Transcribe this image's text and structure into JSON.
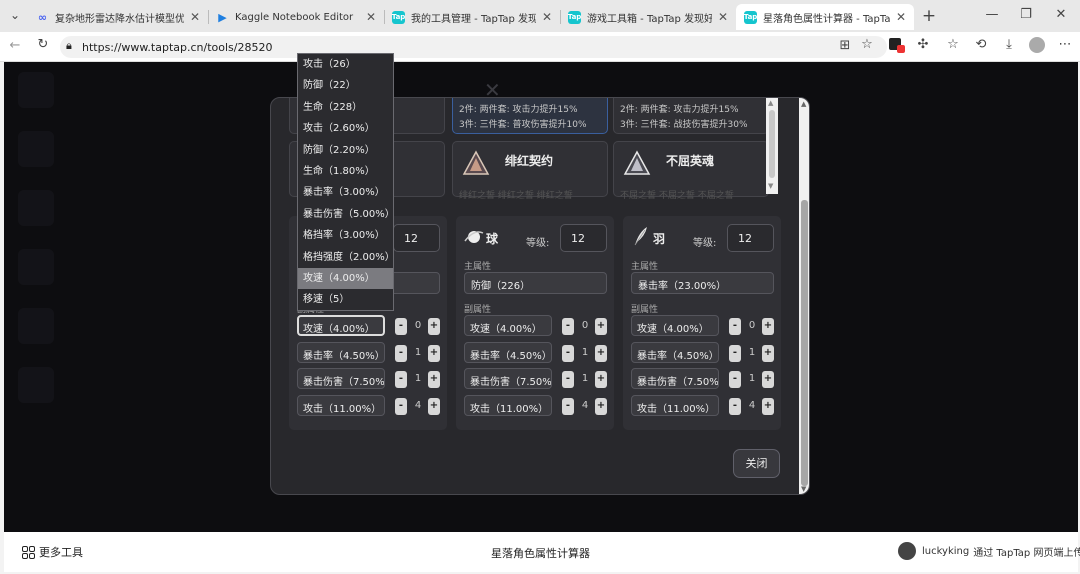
{
  "browser": {
    "tabs": [
      {
        "title": "复杂地形雷达降水估计模型优化",
        "favicon": "ai-icon",
        "color": "#4a63f0"
      },
      {
        "title": "Kaggle Notebook Editor",
        "favicon": "play-icon",
        "color": "#1f7fe0"
      },
      {
        "title": "我的工具管理 - TapTap 发现好游",
        "favicon": "taptap-icon",
        "color": "#15c5ce"
      },
      {
        "title": "游戏工具箱 - TapTap 发现好游戏",
        "favicon": "taptap-icon",
        "color": "#15c5ce"
      },
      {
        "title": "星落角色属性计算器 - TapTap 发",
        "favicon": "taptap-icon",
        "color": "#15c5ce"
      }
    ],
    "url": "https://www.taptap.cn/tools/28520"
  },
  "sets": {
    "top_cards": [
      {
        "lines": [
          "2件: 两件套: 攻击力提升15%",
          "3件: 三件套: 普攻伤害提升10%"
        ],
        "selected": true
      },
      {
        "lines": [
          "2件: 两件套: 攻击力提升15%",
          "3件: 三件套: 战技伤害提升30%"
        ],
        "selected": false
      }
    ],
    "cards": [
      {
        "name": "绯红契约",
        "desc": "绯红之誓 绯红之誓 绯红之誓"
      },
      {
        "name": "不屈英魂",
        "desc": "不屈之誓 不屈之誓 不屈之誓"
      }
    ]
  },
  "pieces": [
    {
      "name": "",
      "level_label": "等级:",
      "level": "12",
      "main_label": "主属性",
      "main": "",
      "sub_label": "副属性",
      "subs": [
        {
          "stat": "攻速（4.00%）",
          "count": "0",
          "minus": "-",
          "plus": "+"
        },
        {
          "stat": "暴击率（4.50%）",
          "count": "1",
          "minus": "-",
          "plus": "+"
        },
        {
          "stat": "暴击伤害（7.50%）",
          "count": "1",
          "minus": "-",
          "plus": "+"
        },
        {
          "stat": "攻击（11.00%）",
          "count": "4",
          "minus": "-",
          "plus": "+"
        }
      ]
    },
    {
      "name": "球",
      "level_label": "等级:",
      "level": "12",
      "main_label": "主属性",
      "main": "防御（226）",
      "sub_label": "副属性",
      "subs": [
        {
          "stat": "攻速（4.00%）",
          "count": "0",
          "minus": "-",
          "plus": "+"
        },
        {
          "stat": "暴击率（4.50%）",
          "count": "1",
          "minus": "-",
          "plus": "+"
        },
        {
          "stat": "暴击伤害（7.50%）",
          "count": "1",
          "minus": "-",
          "plus": "+"
        },
        {
          "stat": "攻击（11.00%）",
          "count": "4",
          "minus": "-",
          "plus": "+"
        }
      ]
    },
    {
      "name": "羽",
      "level_label": "等级:",
      "level": "12",
      "main_label": "主属性",
      "main": "暴击率（23.00%）",
      "sub_label": "副属性",
      "subs": [
        {
          "stat": "攻速（4.00%）",
          "count": "0",
          "minus": "-",
          "plus": "+"
        },
        {
          "stat": "暴击率（4.50%）",
          "count": "1",
          "minus": "-",
          "plus": "+"
        },
        {
          "stat": "暴击伤害（7.50%）",
          "count": "1",
          "minus": "-",
          "plus": "+"
        },
        {
          "stat": "攻击（11.00%）",
          "count": "4",
          "minus": "-",
          "plus": "+"
        }
      ]
    }
  ],
  "dropdown": {
    "options": [
      "攻击（26）",
      "防御（22）",
      "生命（228）",
      "攻击（2.60%）",
      "防御（2.20%）",
      "生命（1.80%）",
      "暴击率（3.00%）",
      "暴击伤害（5.00%）",
      "格挡率（3.00%）",
      "格挡强度（2.00%）",
      "攻速（4.00%）",
      "移速（5）"
    ],
    "highlighted_index": 10
  },
  "modal": {
    "close_label": "关闭"
  },
  "footer": {
    "more_tools": "更多工具",
    "center_title": "星落角色属性计算器",
    "author": "luckyking",
    "upload_text": "通过 TapTap 网页端上传"
  }
}
